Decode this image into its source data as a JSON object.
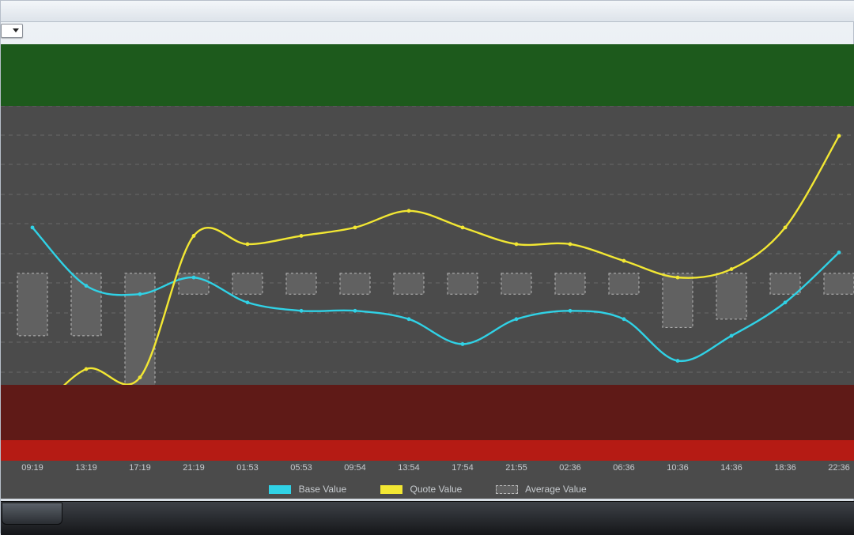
{
  "legend": {
    "base": "Base Value",
    "quote": "Quote Value",
    "avg": "Average Value"
  },
  "xticks": [
    "09:19",
    "13:19",
    "17:19",
    "21:19",
    "01:53",
    "05:53",
    "09:54",
    "13:54",
    "17:54",
    "21:55",
    "02:36",
    "06:36",
    "10:36",
    "14:36",
    "18:36",
    "22:36"
  ],
  "chart_data": {
    "type": "line",
    "title": "",
    "xlabel": "",
    "ylabel": "",
    "ylim": [
      0,
      100
    ],
    "green_band": [
      85,
      100
    ],
    "red_band": [
      0,
      18
    ],
    "categories": [
      "09:19",
      "13:19",
      "17:19",
      "21:19",
      "01:53",
      "05:53",
      "09:54",
      "13:54",
      "17:54",
      "21:55",
      "02:36",
      "06:36",
      "10:36",
      "14:36",
      "18:36",
      "22:36"
    ],
    "series": [
      {
        "name": "Base Value",
        "color": "#30d2e6",
        "values": [
          56,
          42,
          40,
          44,
          38,
          36,
          36,
          34,
          28,
          34,
          36,
          34,
          24,
          30,
          38,
          50
        ]
      },
      {
        "name": "Quote Value",
        "color": "#f2e733",
        "values": [
          10,
          22,
          20,
          54,
          52,
          54,
          56,
          60,
          56,
          52,
          52,
          48,
          44,
          46,
          56,
          78
        ]
      },
      {
        "name": "Average Value",
        "color": "#616161",
        "style": "dashed-box",
        "values": [
          30,
          30,
          18,
          40,
          40,
          40,
          40,
          40,
          40,
          40,
          40,
          40,
          32,
          34,
          40,
          40
        ]
      }
    ]
  }
}
